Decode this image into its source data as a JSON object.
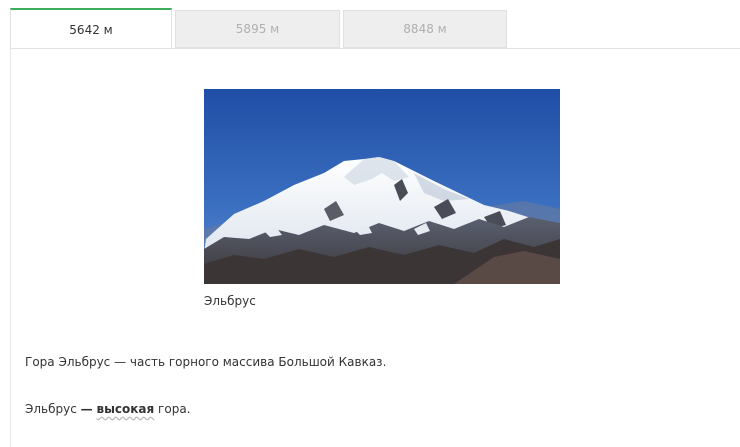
{
  "tabs": [
    {
      "label": "5642 м",
      "active": true
    },
    {
      "label": "5895 м",
      "active": false
    },
    {
      "label": "8848 м",
      "active": false
    }
  ],
  "figure": {
    "image": "mountain-elbrus-photo",
    "caption": "Эльбрус"
  },
  "text": {
    "paragraph1": "Гора Эльбрус — часть горного массива Большой Кавказ.",
    "paragraph2_start": "Эльбрус ",
    "paragraph2_dash": "—",
    "paragraph2_bold": "высокая",
    "paragraph2_end": " гора."
  },
  "colors": {
    "active_tab_accent": "#3dae5e",
    "sky": "#2f5fb0"
  }
}
